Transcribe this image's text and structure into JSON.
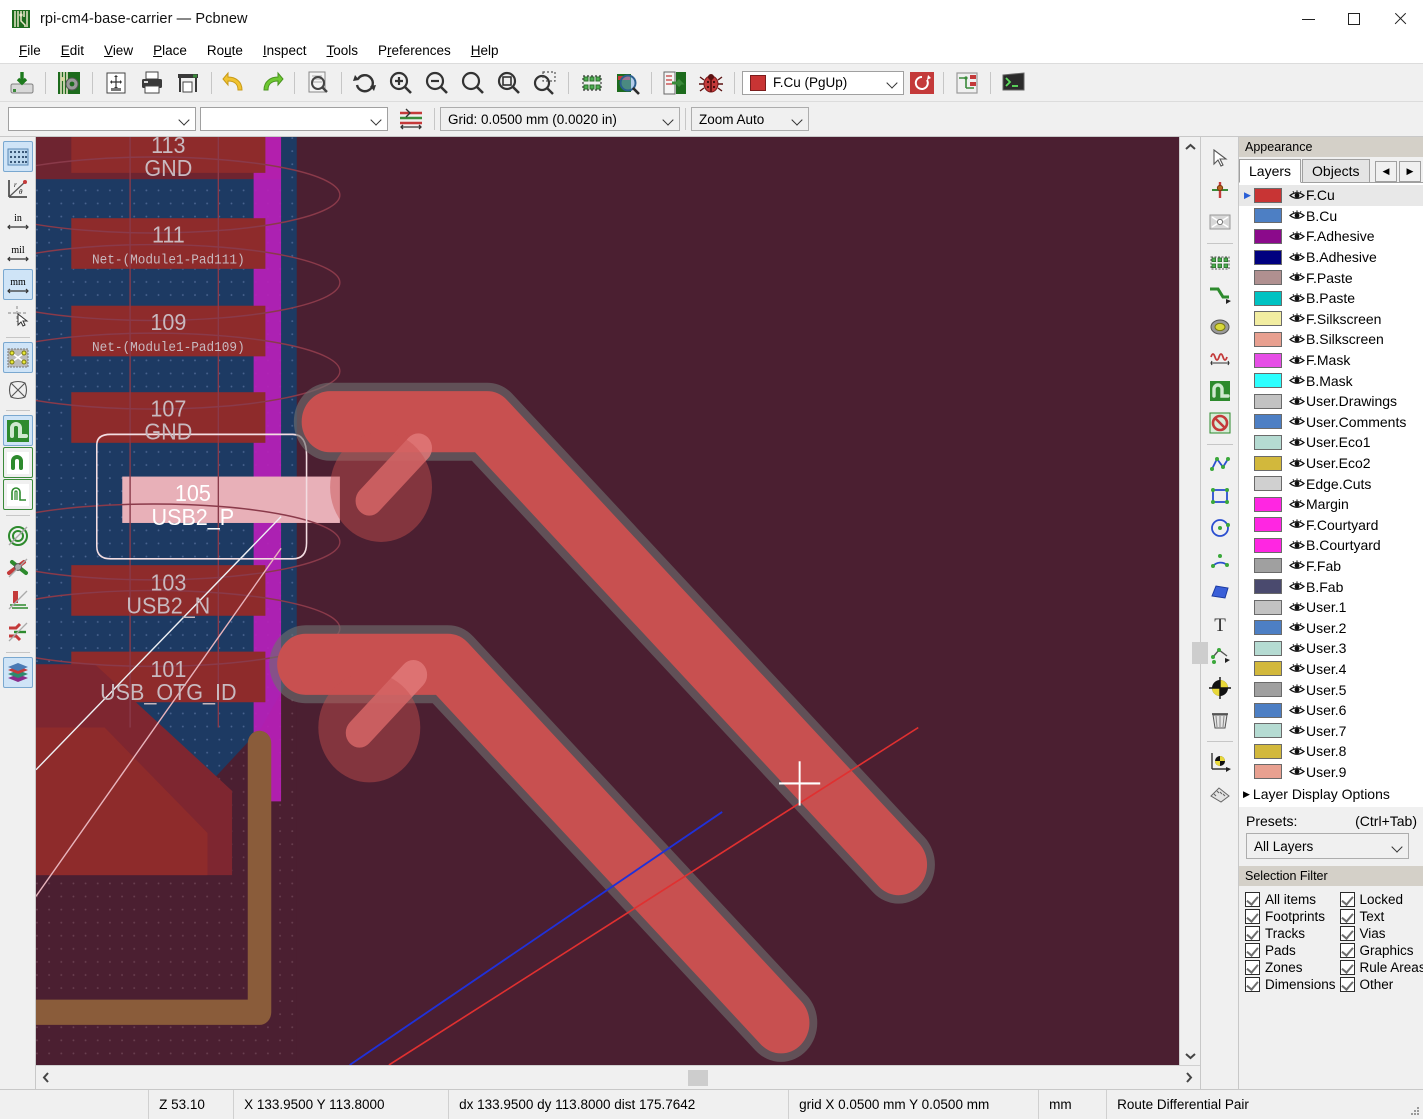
{
  "window": {
    "title": "rpi-cm4-base-carrier — Pcbnew",
    "app_icon": "kicad-pcb-icon",
    "minimize": "–",
    "maximize": "□",
    "close": "×"
  },
  "menubar": [
    {
      "label": "File",
      "accel": "F"
    },
    {
      "label": "Edit",
      "accel": "E"
    },
    {
      "label": "View",
      "accel": "V"
    },
    {
      "label": "Place",
      "accel": "P"
    },
    {
      "label": "Route",
      "accel": "u"
    },
    {
      "label": "Inspect",
      "accel": "I"
    },
    {
      "label": "Tools",
      "accel": "T"
    },
    {
      "label": "Preferences",
      "accel": "r"
    },
    {
      "label": "Help",
      "accel": "H"
    }
  ],
  "toolbar_top": [
    {
      "name": "save-board-icon",
      "tip": "Save board"
    },
    {
      "sep": true
    },
    {
      "name": "board-setup-icon",
      "tip": "Board Setup"
    },
    {
      "sep": true
    },
    {
      "name": "page-settings-icon",
      "tip": "Page settings"
    },
    {
      "name": "print-icon",
      "tip": "Print"
    },
    {
      "name": "plot-icon",
      "tip": "Plot"
    },
    {
      "sep": true
    },
    {
      "name": "undo-icon",
      "tip": "Undo"
    },
    {
      "name": "redo-icon",
      "tip": "Redo"
    },
    {
      "sep": true
    },
    {
      "name": "find-icon",
      "tip": "Find"
    },
    {
      "sep": true
    },
    {
      "name": "refresh-icon",
      "tip": "Refresh"
    },
    {
      "name": "zoom-in-icon",
      "tip": "Zoom in"
    },
    {
      "name": "zoom-out-icon",
      "tip": "Zoom out"
    },
    {
      "name": "zoom-fit-icon",
      "tip": "Zoom to fit"
    },
    {
      "name": "zoom-objects-icon",
      "tip": "Zoom to objects"
    },
    {
      "name": "zoom-area-icon",
      "tip": "Zoom to selection"
    },
    {
      "sep": true
    },
    {
      "name": "footprint-editor-icon",
      "tip": "Footprint editor"
    },
    {
      "name": "footprint-checker-icon",
      "tip": "Footprint checker"
    },
    {
      "sep": true
    },
    {
      "name": "update-pcb-icon",
      "tip": "Update PCB from schematic"
    },
    {
      "name": "drc-icon",
      "tip": "Design rules checker"
    },
    {
      "sep": true
    }
  ],
  "layer_selector": {
    "name": "active-layer-combo",
    "value": "F.Cu (PgUp)",
    "swatch_color": "#c83434"
  },
  "toolbar_top_right": [
    {
      "name": "highcontrast-icon",
      "tip": "High contrast mode"
    },
    {
      "sep": true
    },
    {
      "name": "net-highlight-icon",
      "tip": "Toggle net highlight"
    },
    {
      "sep": true
    },
    {
      "name": "scripting-console-icon",
      "tip": "Show Python scripting console"
    }
  ],
  "toolbar_second": {
    "track_width_combo": {
      "name": "track-width-combo",
      "value": ""
    },
    "via_size_combo": {
      "name": "via-size-combo",
      "value": ""
    },
    "diffpair_icon": {
      "name": "differential-pair-dimensions-icon"
    },
    "grid_combo": {
      "name": "grid-combo",
      "value": "Grid: 0.0500 mm (0.0020 in)"
    },
    "zoom_combo": {
      "name": "zoom-combo",
      "value": "Zoom Auto"
    }
  },
  "left_toolbar": [
    {
      "name": "toggle-grid-icon",
      "active": true
    },
    {
      "name": "polar-coordinates-icon",
      "active": false
    },
    {
      "name": "units-inches-icon",
      "label": "in",
      "active": false
    },
    {
      "name": "units-mils-icon",
      "label": "mil",
      "active": false
    },
    {
      "name": "units-millimeters-icon",
      "label": "mm",
      "active": true
    },
    {
      "name": "toggle-cursor-icon",
      "active": false
    },
    {
      "sep": true
    },
    {
      "name": "show-ratsnest-icon",
      "active": true
    },
    {
      "name": "curved-ratsnest-icon",
      "active": false
    },
    {
      "sep": true
    },
    {
      "name": "track-filled-mode-icon",
      "active": true,
      "green": false
    },
    {
      "name": "track-sketch-mode-icon",
      "active": false,
      "green": true
    },
    {
      "name": "track-outline-mode-icon",
      "active": false,
      "green": true
    },
    {
      "sep": true
    },
    {
      "name": "via-sketch-mode-icon",
      "active": false
    },
    {
      "name": "pad-sketch-mode-icon",
      "active": false
    },
    {
      "name": "zone-filled-icon",
      "active": false
    },
    {
      "name": "zone-outline-icon",
      "active": false
    },
    {
      "sep": true
    },
    {
      "name": "layers-manager-icon",
      "active": true
    }
  ],
  "right_toolbar": [
    {
      "name": "select-tool-icon"
    },
    {
      "name": "local-ratsnest-icon"
    },
    {
      "name": "highlight-net-icon"
    },
    {
      "sep": true
    },
    {
      "name": "place-footprint-icon"
    },
    {
      "name": "route-tracks-icon"
    },
    {
      "name": "add-via-icon"
    },
    {
      "name": "tune-length-icon"
    },
    {
      "name": "add-filled-zone-icon"
    },
    {
      "name": "add-keepout-zone-icon"
    },
    {
      "sep": true
    },
    {
      "name": "draw-line-icon"
    },
    {
      "name": "draw-rectangle-icon"
    },
    {
      "name": "draw-circle-icon"
    },
    {
      "name": "draw-arc-icon"
    },
    {
      "name": "draw-polygon-icon"
    },
    {
      "name": "add-text-icon"
    },
    {
      "name": "add-dimension-icon"
    },
    {
      "name": "place-target-icon"
    },
    {
      "name": "delete-tool-icon"
    },
    {
      "sep": true
    },
    {
      "name": "set-origin-icon"
    },
    {
      "name": "measure-tool-icon"
    }
  ],
  "appearance": {
    "panel_title": "Appearance",
    "tabs": [
      {
        "label": "Layers",
        "selected": true
      },
      {
        "label": "Objects",
        "selected": false
      }
    ],
    "nav_prev": "◀",
    "nav_next": "▶",
    "layers": [
      {
        "name": "F.Cu",
        "color": "#c83434",
        "visible": true,
        "selected": true
      },
      {
        "name": "B.Cu",
        "color": "#4d7fc4",
        "visible": true,
        "selected": false
      },
      {
        "name": "F.Adhesive",
        "color": "#8b0a8b",
        "visible": true,
        "selected": false
      },
      {
        "name": "B.Adhesive",
        "color": "#00007f",
        "visible": true,
        "selected": false
      },
      {
        "name": "F.Paste",
        "color": "#b09090",
        "visible": true,
        "selected": false
      },
      {
        "name": "B.Paste",
        "color": "#00c2c2",
        "visible": true,
        "selected": false
      },
      {
        "name": "F.Silkscreen",
        "color": "#f2eda1",
        "visible": true,
        "selected": false
      },
      {
        "name": "B.Silkscreen",
        "color": "#e8a090",
        "visible": true,
        "selected": false
      },
      {
        "name": "F.Mask",
        "color": "#e64ee6",
        "visible": true,
        "selected": false
      },
      {
        "name": "B.Mask",
        "color": "#2dffff",
        "visible": true,
        "selected": false
      },
      {
        "name": "User.Drawings",
        "color": "#c2c2c2",
        "visible": true,
        "selected": false
      },
      {
        "name": "User.Comments",
        "color": "#4d7fc4",
        "visible": true,
        "selected": false
      },
      {
        "name": "User.Eco1",
        "color": "#b5dbd2",
        "visible": true,
        "selected": false
      },
      {
        "name": "User.Eco2",
        "color": "#d2b83c",
        "visible": true,
        "selected": false
      },
      {
        "name": "Edge.Cuts",
        "color": "#d0d0d0",
        "visible": true,
        "selected": false
      },
      {
        "name": "Margin",
        "color": "#ff26e2",
        "visible": true,
        "selected": false
      },
      {
        "name": "F.Courtyard",
        "color": "#ff26e2",
        "visible": true,
        "selected": false
      },
      {
        "name": "B.Courtyard",
        "color": "#ff26e2",
        "visible": true,
        "selected": false
      },
      {
        "name": "F.Fab",
        "color": "#a0a0a0",
        "visible": true,
        "selected": false
      },
      {
        "name": "B.Fab",
        "color": "#4a4a6e",
        "visible": true,
        "selected": false
      },
      {
        "name": "User.1",
        "color": "#c2c2c2",
        "visible": true,
        "selected": false
      },
      {
        "name": "User.2",
        "color": "#4d7fc4",
        "visible": true,
        "selected": false
      },
      {
        "name": "User.3",
        "color": "#b5dbd2",
        "visible": true,
        "selected": false
      },
      {
        "name": "User.4",
        "color": "#d2b83c",
        "visible": true,
        "selected": false
      },
      {
        "name": "User.5",
        "color": "#a0a0a0",
        "visible": true,
        "selected": false
      },
      {
        "name": "User.6",
        "color": "#4d7fc4",
        "visible": true,
        "selected": false
      },
      {
        "name": "User.7",
        "color": "#b5dbd2",
        "visible": true,
        "selected": false
      },
      {
        "name": "User.8",
        "color": "#d2b83c",
        "visible": true,
        "selected": false
      },
      {
        "name": "User.9",
        "color": "#e8a090",
        "visible": true,
        "selected": false
      }
    ],
    "layer_display_options": "Layer Display Options",
    "presets_label": "Presets:",
    "presets_hint": "(Ctrl+Tab)",
    "presets_value": "All Layers",
    "selection_filter_title": "Selection Filter",
    "selection_filter_left": [
      {
        "label": "All items",
        "checked": true
      },
      {
        "label": "Footprints",
        "checked": true
      },
      {
        "label": "Tracks",
        "checked": true
      },
      {
        "label": "Pads",
        "checked": true
      },
      {
        "label": "Zones",
        "checked": true
      },
      {
        "label": "Dimensions",
        "checked": true
      }
    ],
    "selection_filter_right": [
      {
        "label": "Locked",
        "checked": true
      },
      {
        "label": "Text",
        "checked": true
      },
      {
        "label": "Vias",
        "checked": true
      },
      {
        "label": "Graphics",
        "checked": true
      },
      {
        "label": "Rule Areas",
        "checked": true
      },
      {
        "label": "Other",
        "checked": true
      }
    ]
  },
  "statusbar": {
    "zoom": "Z 53.10",
    "position": "X 133.9500  Y 113.8000",
    "delta": "dx 133.9500  dy 113.8000  dist 175.7642",
    "grid": "grid X 0.0500 mm  Y 0.0500 mm",
    "units": "mm",
    "tool": "Route Differential Pair"
  },
  "canvas": {
    "background": "#3b1e2b",
    "pads": [
      {
        "number": "113",
        "net": "GND",
        "clipped": true
      },
      {
        "number": "111",
        "net": "Net-(Module1-Pad111)",
        "clipped": false
      },
      {
        "number": "109",
        "net": "Net-(Module1-Pad109)",
        "clipped": false
      },
      {
        "number": "107",
        "net": "GND",
        "clipped": false
      },
      {
        "number": "105",
        "net": "USB2_P",
        "clipped": false,
        "highlighted": true
      },
      {
        "number": "103",
        "net": "USB2_N",
        "clipped": false
      },
      {
        "number": "101",
        "net": "USB_OTG_ID",
        "clipped": false
      }
    ],
    "colors": {
      "fcu_track": "#c85050",
      "fcu_pad": "#8e2b2b",
      "bcu_zone": "#1d3a63",
      "fmask": "#b81fb8",
      "edge_cuts": "#8a5c3a",
      "clearance_outline": "#6f6f6f",
      "ratsnest": "#ffffff",
      "crosshair": "#ffffff"
    }
  }
}
